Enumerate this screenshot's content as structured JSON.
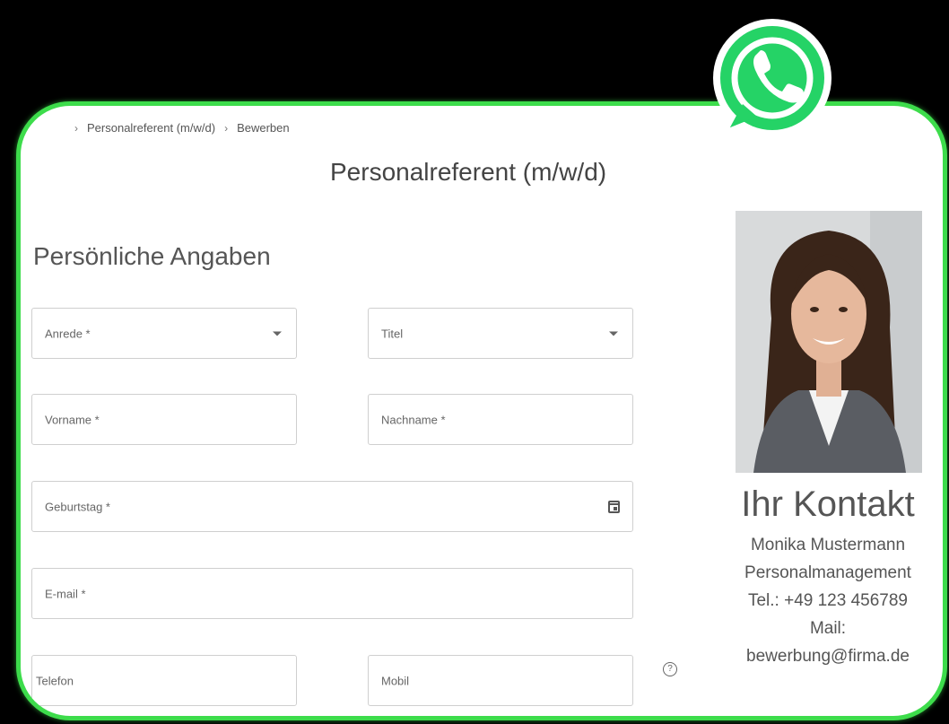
{
  "breadcrumb": {
    "items": [
      "Personalreferent (m/w/d)",
      "Bewerben"
    ]
  },
  "job": {
    "title": "Personalreferent (m/w/d)"
  },
  "form": {
    "section_title": "Persönliche Angaben",
    "anrede": "Anrede *",
    "titel": "Titel",
    "vorname": "Vorname *",
    "nachname": "Nachname *",
    "geburtstag": "Geburtstag *",
    "email": "E-mail *",
    "telefon": "Telefon",
    "mobil": "Mobil",
    "help": "?"
  },
  "contact": {
    "heading": "Ihr Kontakt",
    "name": "Monika Mustermann",
    "department": "Personalmanagement",
    "phone": "Tel.: +49 123 456789",
    "mail_label": "Mail:",
    "mail": "bewerbung@firma.de"
  },
  "icons": {
    "whatsapp": "whatsapp-icon",
    "calendar": "calendar-icon",
    "help": "help-circle-icon"
  },
  "colors": {
    "frame_border": "#3ddc4b",
    "whatsapp_green": "#25d366"
  }
}
